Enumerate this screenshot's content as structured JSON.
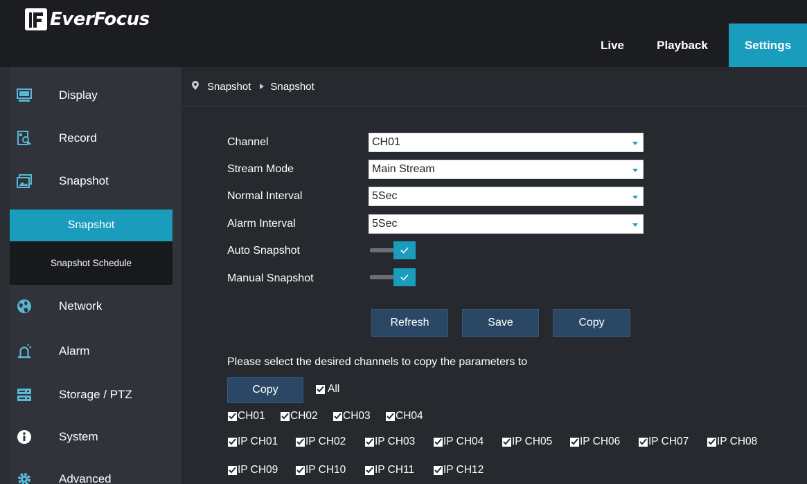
{
  "brand": {
    "name": "EverFocus"
  },
  "topnav": {
    "live": "Live",
    "playback": "Playback",
    "settings": "Settings"
  },
  "sidebar": {
    "items": [
      {
        "label": "Display",
        "icon": "monitor-icon"
      },
      {
        "label": "Record",
        "icon": "record-search-icon"
      },
      {
        "label": "Snapshot",
        "icon": "image-icon"
      },
      {
        "label": "Network",
        "icon": "network-globe-icon"
      },
      {
        "label": "Alarm",
        "icon": "siren-icon"
      },
      {
        "label": "Storage / PTZ",
        "icon": "storage-icon"
      },
      {
        "label": "System",
        "icon": "info-icon"
      },
      {
        "label": "Advanced",
        "icon": "gear-icon"
      }
    ],
    "submenu": {
      "active": "Snapshot",
      "other": "Snapshot Schedule"
    }
  },
  "breadcrumb": {
    "section": "Snapshot",
    "page": "Snapshot"
  },
  "form": {
    "channel": {
      "label": "Channel",
      "value": "CH01"
    },
    "stream_mode": {
      "label": "Stream Mode",
      "value": "Main Stream"
    },
    "normal_interval": {
      "label": "Normal Interval",
      "value": "5Sec"
    },
    "alarm_interval": {
      "label": "Alarm Interval",
      "value": "5Sec"
    },
    "auto_snapshot": {
      "label": "Auto Snapshot",
      "enabled": true
    },
    "manual_snapshot": {
      "label": "Manual Snapshot",
      "enabled": true
    }
  },
  "buttons": {
    "refresh": "Refresh",
    "save": "Save",
    "copy": "Copy"
  },
  "copy_section": {
    "hint": "Please select the desired channels to copy the parameters to",
    "copy_button": "Copy",
    "all_label": "All",
    "channels": [
      "CH01",
      "CH02",
      "CH03",
      "CH04"
    ],
    "ip_channels_row1": [
      "IP CH01",
      "IP CH02",
      "IP CH03",
      "IP CH04",
      "IP CH05",
      "IP CH06",
      "IP CH07",
      "IP CH08"
    ],
    "ip_channels_row2": [
      "IP CH09",
      "IP CH10",
      "IP CH11",
      "IP CH12"
    ],
    "all_checked": true
  },
  "colors": {
    "accent": "#1a9dbd",
    "button": "#2a4866",
    "topbar": "#1b1d21",
    "sidebar": "#30343a",
    "background": "#26292e"
  }
}
